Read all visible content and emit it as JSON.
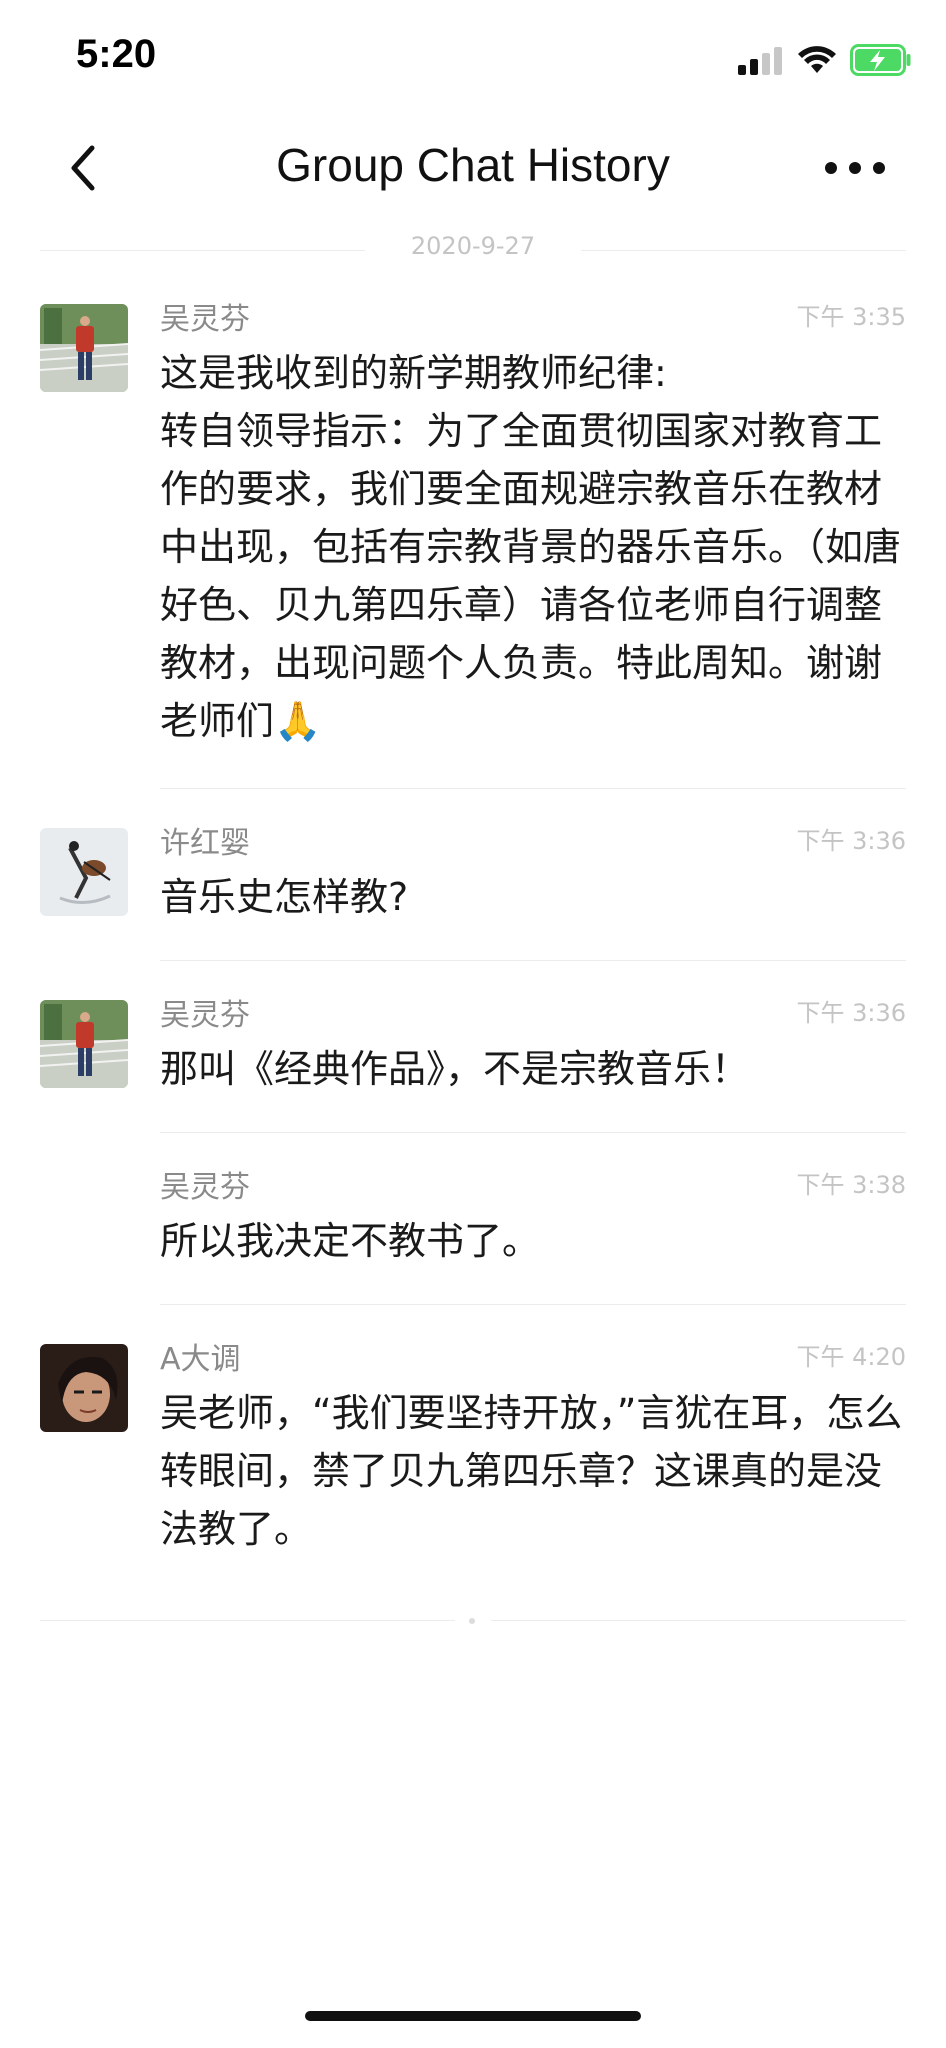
{
  "status_bar": {
    "time": "5:20",
    "battery_color": "#4cd964"
  },
  "nav": {
    "title": "Group Chat History",
    "back_icon": "chevron-left-icon",
    "more_icon": "ellipsis-icon"
  },
  "date_separator": "2020-9-27",
  "messages": [
    {
      "sender": "吴灵芬",
      "time": "下午 3:35",
      "text": "这是我收到的新学期教师纪律:\n转自领导指示：为了全面贯彻国家对教育工作的要求，我们要全面规避宗教音乐在教材中出现，包括有宗教背景的器乐音乐。（如唐好色、贝九第四乐章）请各位老师自行调整教材，出现问题个人负责。特此周知。谢谢老师们🙏"
    },
    {
      "sender": "许红婴",
      "time": "下午 3:36",
      "text": "音乐史怎样教?"
    },
    {
      "sender": "吴灵芬",
      "time": "下午 3:36",
      "text": "那叫《经典作品》，不是宗教音乐！"
    },
    {
      "sender": "吴灵芬",
      "time": "下午 3:38",
      "text": "所以我决定不教书了。"
    },
    {
      "sender": "A大调",
      "time": "下午 4:20",
      "text": "吴老师，“我们要坚持开放，”言犹在耳，怎么转眼间，禁了贝九第四乐章？这课真的是没法教了。"
    }
  ]
}
